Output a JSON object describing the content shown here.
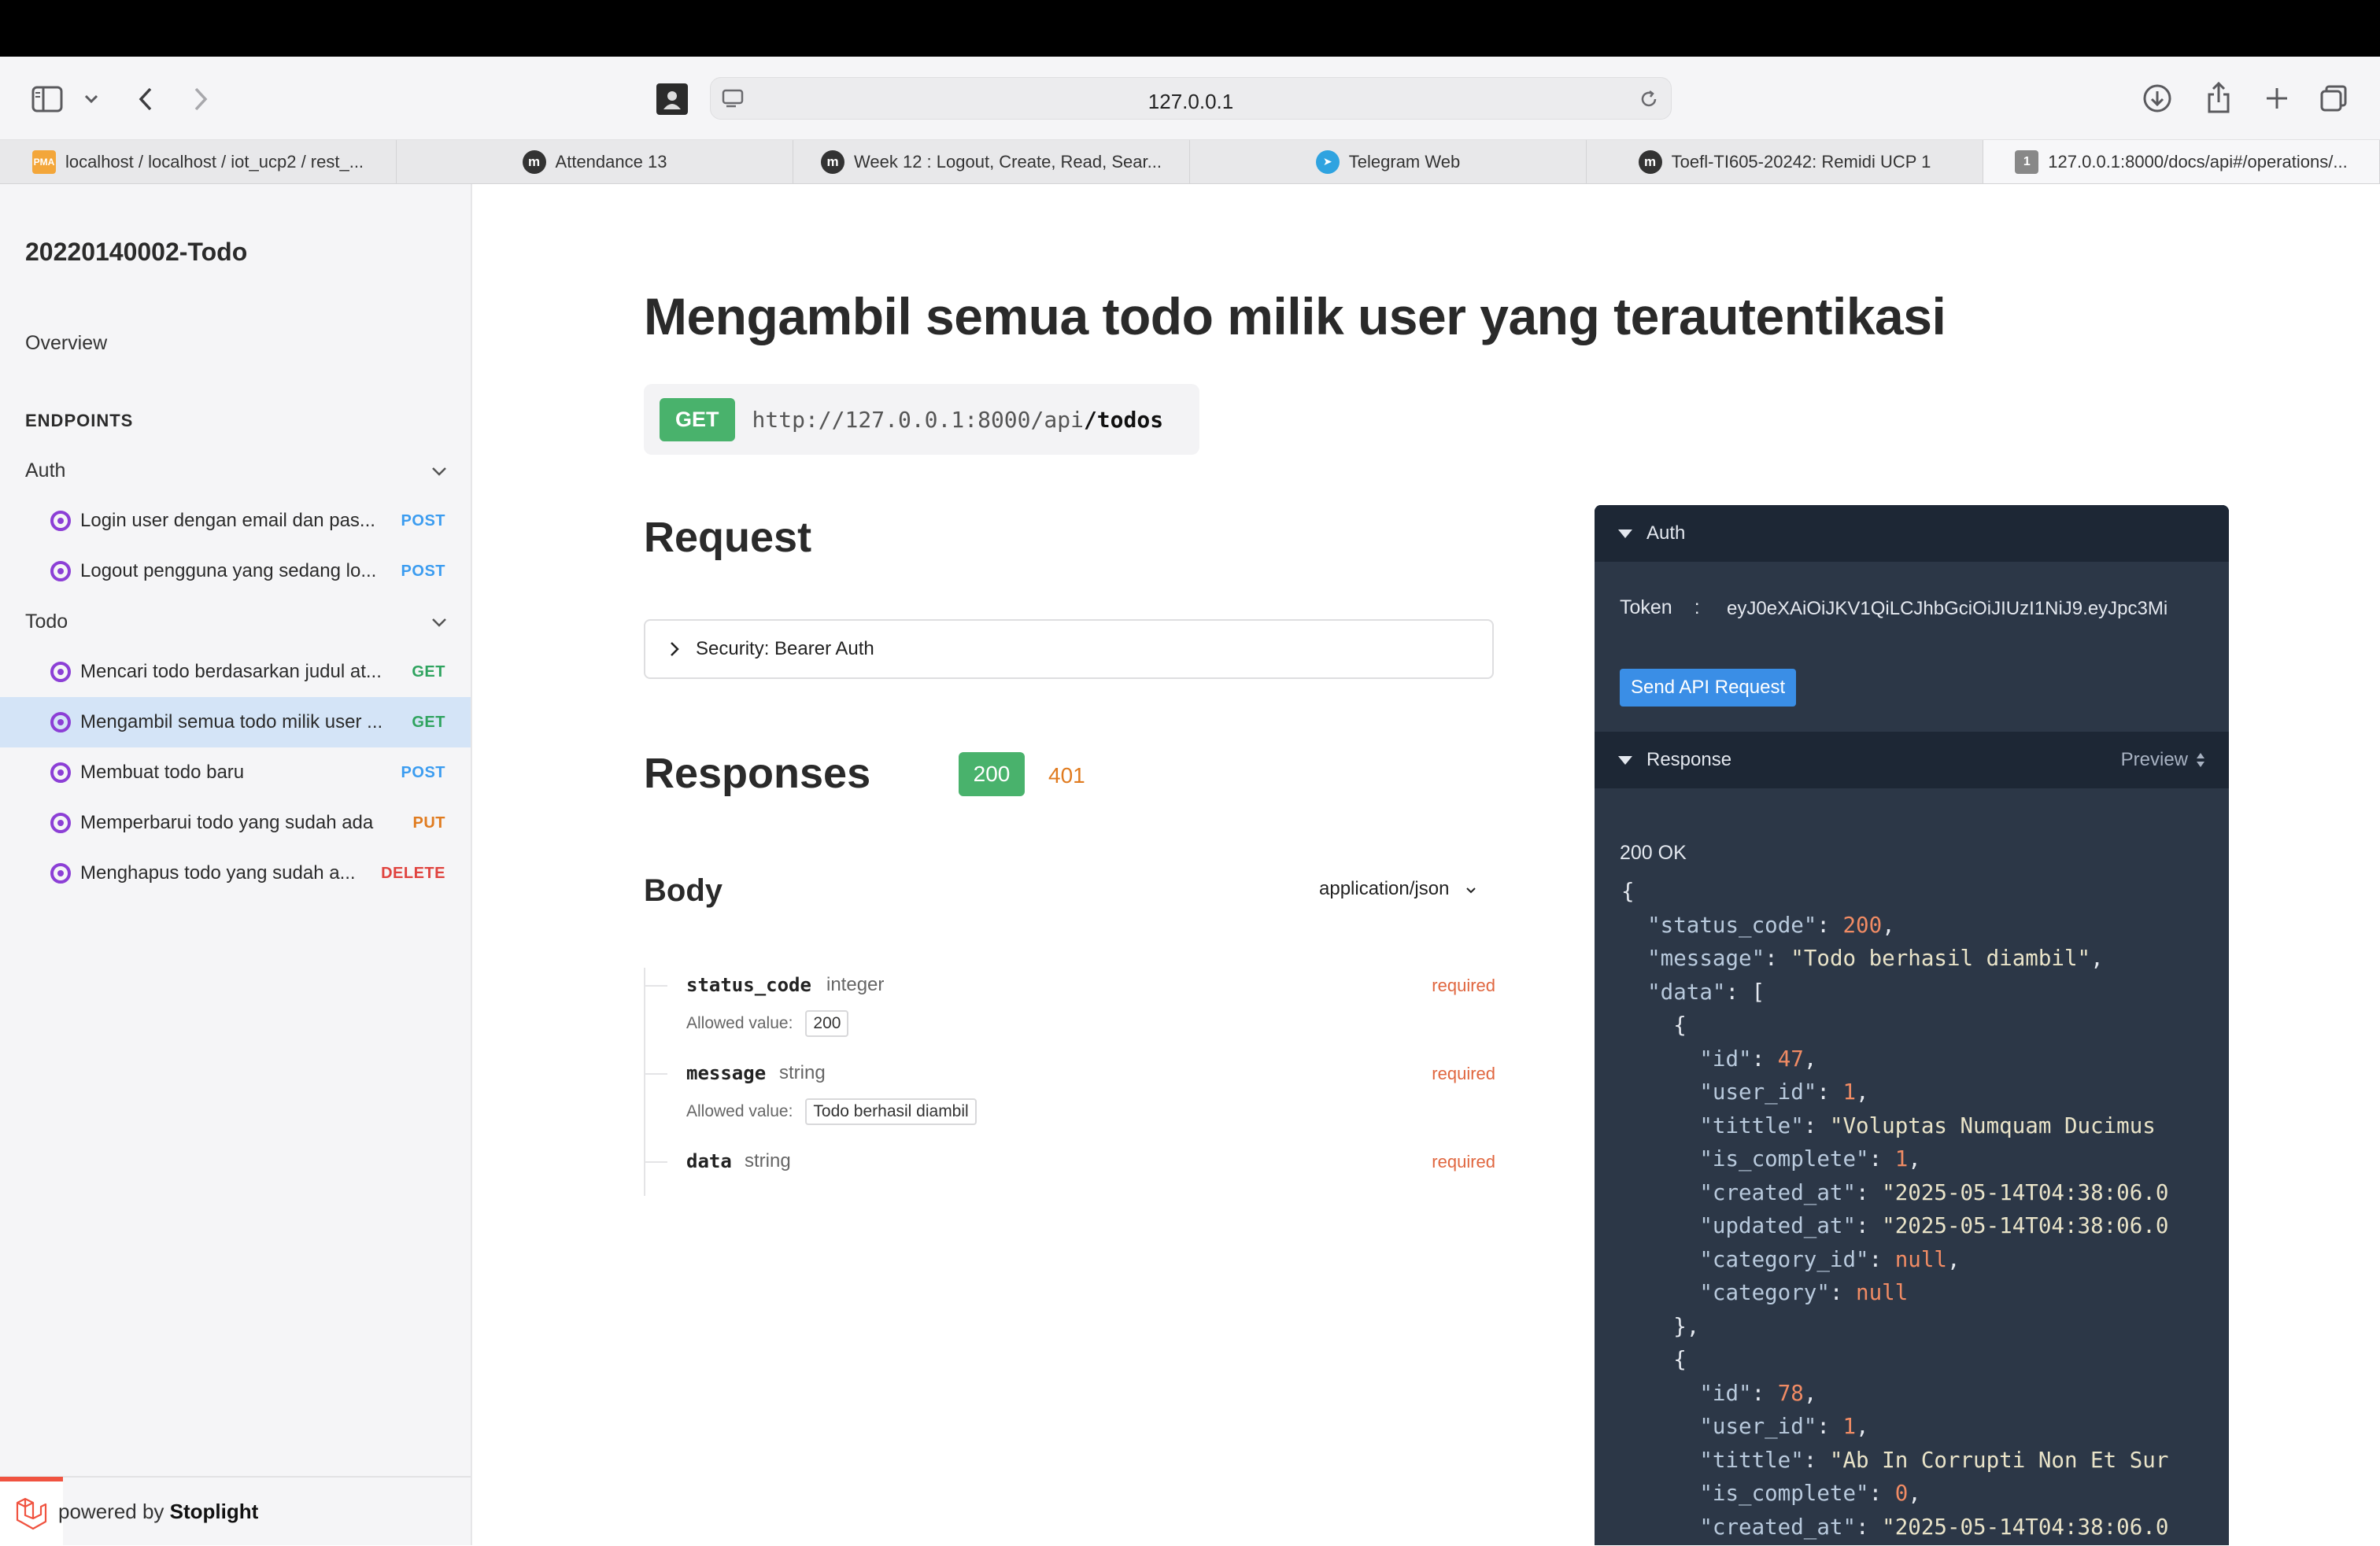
{
  "browser": {
    "url": "127.0.0.1"
  },
  "tabs": [
    {
      "label": "localhost / localhost / iot_ucp2 / rest_...",
      "icon": "pma-icon",
      "icon_text": "PMA"
    },
    {
      "label": "Attendance 13",
      "icon": "moodle-icon",
      "icon_text": "m"
    },
    {
      "label": "Week 12 : Logout, Create, Read, Sear...",
      "icon": "moodle-icon",
      "icon_text": "m"
    },
    {
      "label": "Telegram Web",
      "icon": "telegram-icon",
      "icon_text": "➤"
    },
    {
      "label": "Toefl-TI605-20242: Remidi UCP 1",
      "icon": "moodle-icon",
      "icon_text": "m"
    },
    {
      "label": "127.0.0.1:8000/docs/api#/operations/...",
      "icon": "page-icon",
      "icon_text": "1"
    }
  ],
  "sidebar": {
    "title": "20220140002-Todo",
    "overview": "Overview",
    "endpoints_label": "ENDPOINTS",
    "groups": [
      {
        "label": "Auth"
      },
      {
        "label": "Todo"
      }
    ],
    "items": [
      {
        "label": "Login user dengan email dan pas...",
        "method": "POST"
      },
      {
        "label": "Logout pengguna yang sedang lo...",
        "method": "POST"
      },
      {
        "label": "Mencari todo berdasarkan judul at...",
        "method": "GET"
      },
      {
        "label": "Mengambil semua todo milik user ...",
        "method": "GET"
      },
      {
        "label": "Membuat todo baru",
        "method": "POST"
      },
      {
        "label": "Memperbarui todo yang sudah ada",
        "method": "PUT"
      },
      {
        "label": "Menghapus todo yang sudah a...",
        "method": "DELETE"
      }
    ],
    "footer": {
      "prefix": "powered by",
      "brand": "Stoplight"
    }
  },
  "main": {
    "title": "Mengambil semua todo milik user yang terautentikasi",
    "method": "GET",
    "url_base": "http://127.0.0.1:8000/api",
    "url_path": "/todos",
    "request_heading": "Request",
    "security_label": "Security: Bearer Auth",
    "responses_heading": "Responses",
    "codes": [
      "200",
      "401"
    ],
    "body_heading": "Body",
    "content_type": "application/json",
    "allowed_label": "Allowed value:",
    "fields": [
      {
        "name": "status_code",
        "type": "integer",
        "required": "required",
        "allowed": "200"
      },
      {
        "name": "message",
        "type": "string",
        "required": "required",
        "allowed": "Todo berhasil diambil"
      },
      {
        "name": "data",
        "type": "string",
        "required": "required",
        "allowed": ""
      }
    ]
  },
  "panel": {
    "auth_label": "Auth",
    "token_label": "Token",
    "token_sep": ":",
    "token_value": "eyJ0eXAiOiJKV1QiLCJhbGciOiJIUzI1NiJ9.eyJpc3Mi",
    "send_label": "Send API Request",
    "response_label": "Response",
    "preview_label": "Preview",
    "status": "200 OK",
    "json": {
      "status_code": 200,
      "message": "Todo berhasil diambil",
      "items": [
        {
          "id": 47,
          "user_id": 1,
          "tittle": "Voluptas Numquam Ducimus",
          "is_complete": 1,
          "created_at": "2025-05-14T04:38:06.0",
          "updated_at": "2025-05-14T04:38:06.0",
          "category_id": "null",
          "category": "null"
        },
        {
          "id": 78,
          "user_id": 1,
          "tittle": "Ab In Corrupti Non Et Sur",
          "is_complete": 0,
          "created_at": "2025-05-14T04:38:06.0"
        }
      ]
    }
  }
}
